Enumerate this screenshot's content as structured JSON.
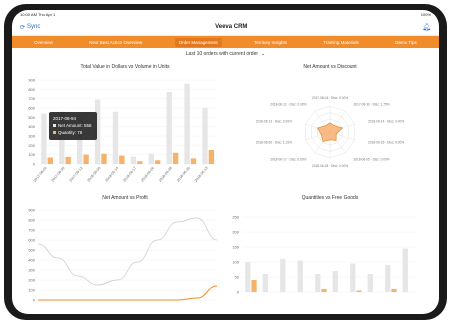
{
  "status": {
    "time": "10:00 AM Thu Apr 1",
    "battery": "100%"
  },
  "app": {
    "sync_label": "Sync",
    "title": "Veeva CRM"
  },
  "tabs": [
    {
      "label": "Overview"
    },
    {
      "label": "Next Best Action Overview"
    },
    {
      "label": "Order Management"
    },
    {
      "label": "Territory Insights"
    },
    {
      "label": "Training Materials"
    },
    {
      "label": "Demo Tips"
    }
  ],
  "subheader": "Last 10 orders with current order",
  "panels": {
    "total_value_title": "Total Value in Dollars vs Volume in Units",
    "discount_title": "Net Amount vs Discount",
    "profit_title": "Net Amount vs Profit",
    "free_goods_title": "Quantities vs Free Goods"
  },
  "tooltip": {
    "date": "2017-08-94",
    "line1": "Net Amount: 556",
    "line2": "Quantity: 76"
  },
  "chart_data": [
    {
      "type": "bar",
      "title": "Total Value in Dollars vs Volume in Units",
      "categories": [
        "2017-08-04",
        "2017-08-30",
        "2017-09-12",
        "2018-06-05",
        "2018-06-14",
        "2018-06-17",
        "2018-06-26",
        "2018-06-28",
        "2018-06-30",
        "2018-06-13"
      ],
      "series": [
        {
          "values": [
            540,
            560,
            500,
            690,
            560,
            80,
            110,
            770,
            860,
            600
          ],
          "color": "#e6e6e6"
        },
        {
          "values": [
            70,
            76,
            100,
            110,
            90,
            30,
            40,
            120,
            60,
            150
          ],
          "color": "#f5b26b"
        }
      ],
      "yticks": [
        "0",
        "100",
        "200",
        "300",
        "400",
        "500",
        "600",
        "700",
        "800",
        "900"
      ],
      "ylim": [
        0,
        900
      ]
    },
    {
      "type": "radar",
      "title": "Net Amount vs Discount",
      "labels": [
        "2017-08-04 · Disc: 0.00%",
        "2017-08-30 · Disc: 1.75%",
        "2018-06-14 · Disc: 0.00%",
        "2018-06-26 · Disc: 0.00%",
        "2018-06-05 · Disc: 0.00%",
        "2018-06-28 · Disc: 0.00%",
        "2018-06-17 · Disc: 0.00%",
        "2018-06-30 · Disc: 1.15%",
        "2018-06-13 · Disc: 0.00%",
        "2018-06-12 · Disc: 0.00%"
      ],
      "values": [
        0.35,
        0.3,
        0.5,
        0.25,
        0.4,
        0.3,
        0.45,
        0.35,
        0.5,
        0.3
      ]
    },
    {
      "type": "line",
      "title": "Net Amount vs Profit",
      "yticks": [
        "0",
        "100",
        "200",
        "300",
        "400",
        "500",
        "600",
        "700",
        "800",
        "900"
      ],
      "ylim": [
        0,
        900
      ],
      "series": [
        {
          "values": [
            560,
            420,
            240,
            150,
            200,
            380,
            600,
            780,
            820,
            600
          ],
          "color": "#c8c8c8"
        },
        {
          "values": [
            0,
            0,
            0,
            0,
            0,
            0,
            0,
            0,
            20,
            140
          ],
          "color": "#f08c2a"
        }
      ]
    },
    {
      "type": "bar",
      "title": "Quantities vs Free Goods",
      "yticks": [
        "0",
        "50",
        "100",
        "150",
        "200",
        "250"
      ],
      "ylim": [
        0,
        250
      ],
      "series": [
        {
          "values": [
            100,
            60,
            110,
            105,
            60,
            70,
            95,
            60,
            90,
            145
          ],
          "color": "#e6e6e6"
        },
        {
          "values": [
            40,
            0,
            0,
            0,
            10,
            0,
            5,
            0,
            10,
            0
          ],
          "color": "#f5b26b"
        }
      ]
    }
  ]
}
